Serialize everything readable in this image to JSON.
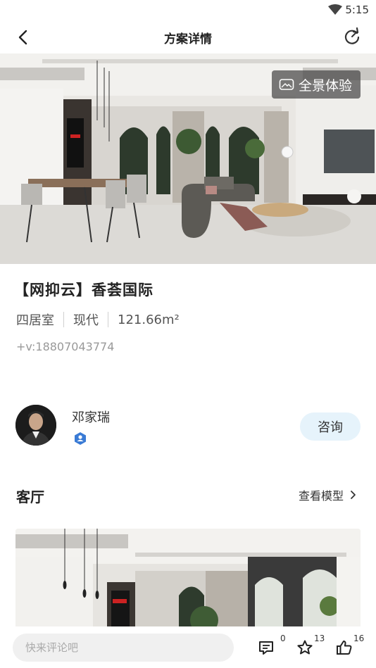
{
  "status_bar": {
    "time": "5:15",
    "icons": [
      "wifi-icon"
    ]
  },
  "nav": {
    "title": "方案详情",
    "icons": [
      "back-arrow-icon",
      "refresh-icon"
    ]
  },
  "hero": {
    "panorama_label": "全景体验",
    "panorama_icon": "vr-icon"
  },
  "plan": {
    "title": "【网抑云】香荟国际",
    "tags": [
      "四居室",
      "现代",
      "121.66m²"
    ],
    "contact": "+v:18807043774"
  },
  "designer": {
    "name": "邓家瑞",
    "badge_icon": "verified-badge-icon",
    "consult_label": "咨询"
  },
  "room": {
    "title": "客厅",
    "view_model_label": "查看模型"
  },
  "bottom_bar": {
    "comment_placeholder": "快来评论吧",
    "comments_count": "0",
    "favorites_count": "13",
    "likes_count": "16"
  },
  "colors": {
    "consult_bg": "#e6f3fb",
    "badge_blue": "#3a7bd5",
    "input_bg": "#f0f0f0"
  }
}
